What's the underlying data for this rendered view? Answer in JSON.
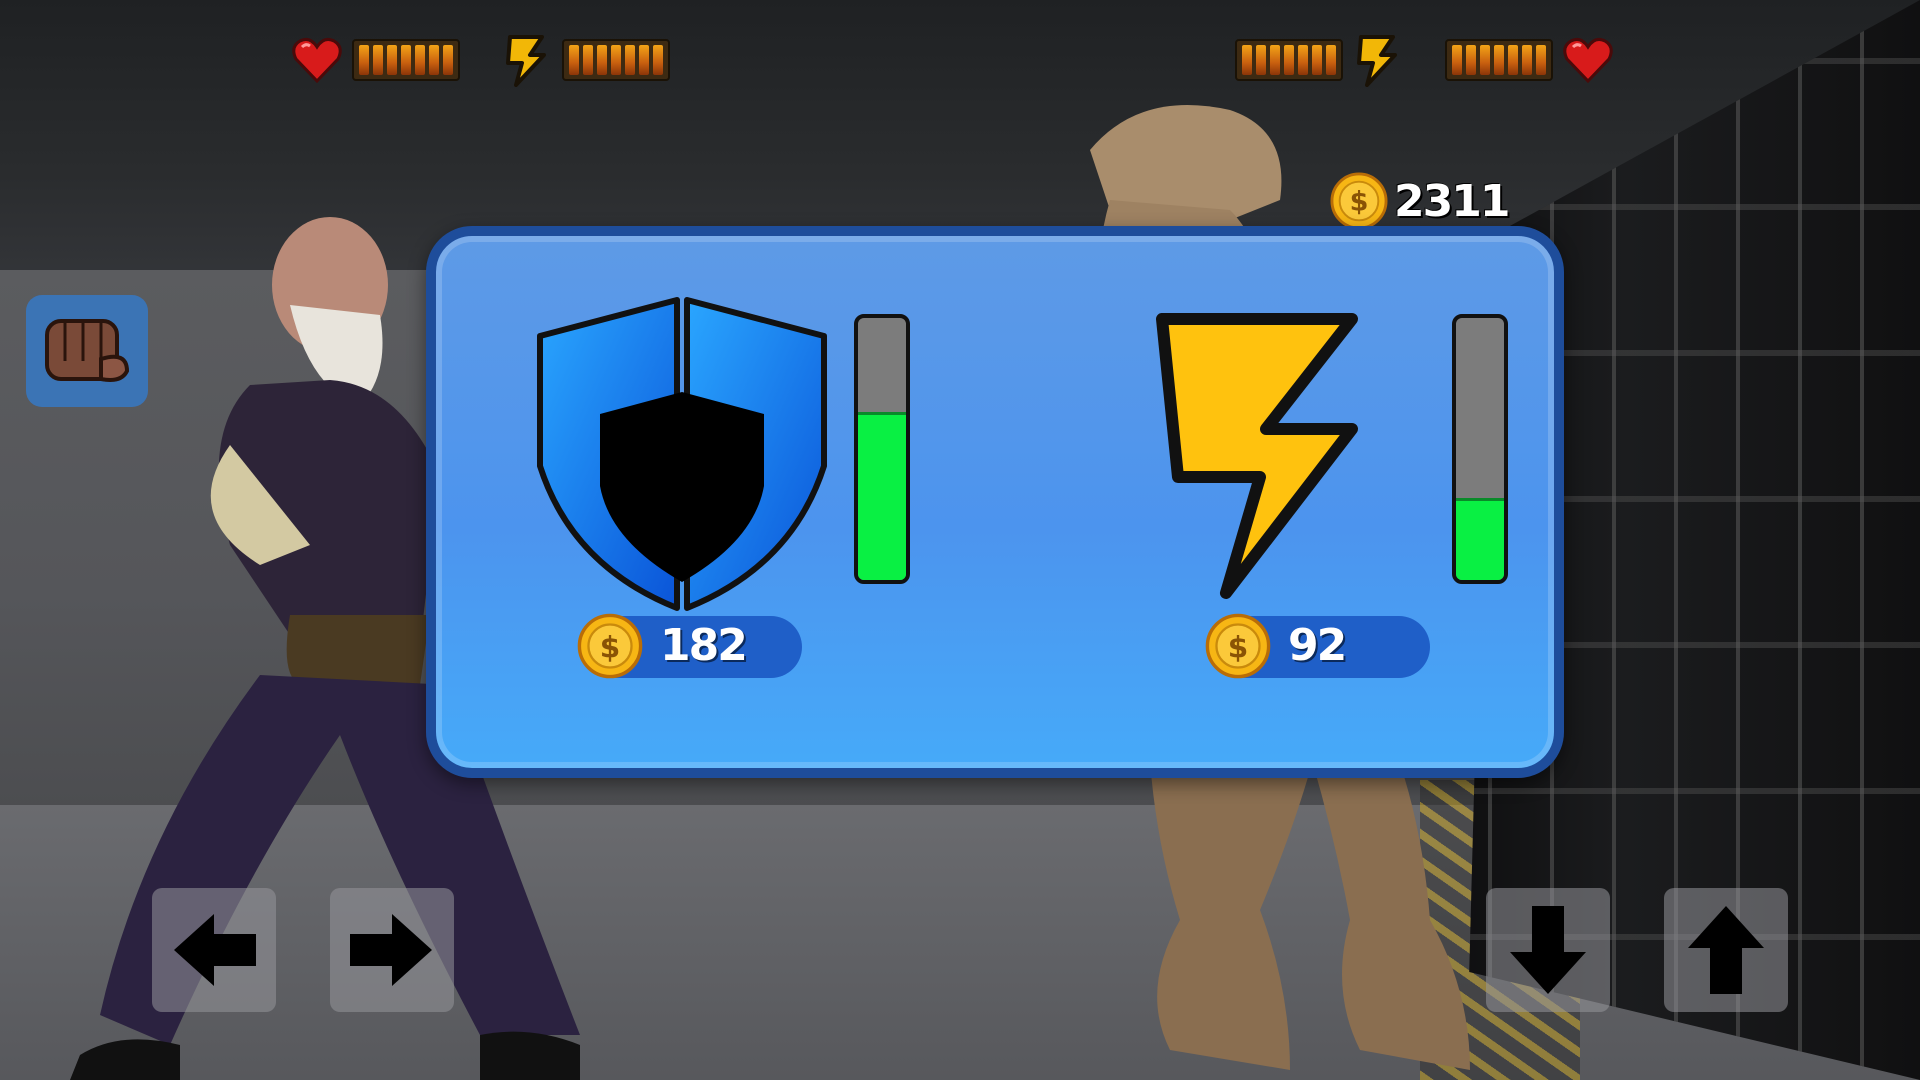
{
  "hud": {
    "player": {
      "health_segments": 7,
      "energy_segments": 7
    },
    "enemy": {
      "health_segments": 7,
      "energy_segments": 7
    }
  },
  "coins": {
    "total": "2311"
  },
  "shop": {
    "shield": {
      "icon": "shield-icon",
      "price": "182",
      "level_fraction": 0.63
    },
    "energy": {
      "icon": "lightning-icon",
      "price": "92",
      "level_fraction": 0.3
    }
  },
  "controls": {
    "attack": "fist-icon",
    "left": "arrow-left-icon",
    "right": "arrow-right-icon",
    "down": "arrow-down-icon",
    "up": "arrow-up-icon"
  },
  "colors": {
    "dialog_blue": "#4c94ee",
    "dialog_border": "#1e4d9b",
    "meter_fill": "#09f043",
    "bolt_yellow": "#ffc20e",
    "hud_bar_orange": "#e88a14"
  }
}
